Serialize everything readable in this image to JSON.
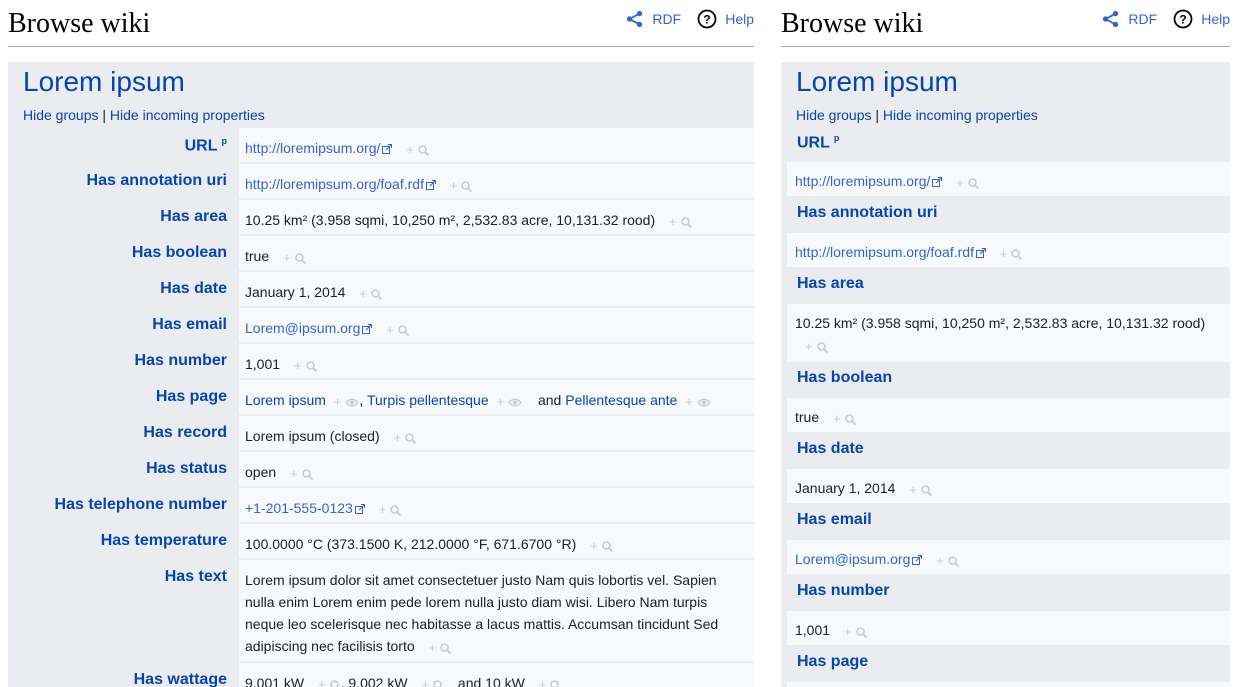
{
  "header": {
    "title": "Browse wiki",
    "rdf_label": "RDF",
    "help_label": "Help"
  },
  "subject": {
    "title": "Lorem ipsum",
    "hide_groups": "Hide groups",
    "divider": "|",
    "hide_incoming": "Hide incoming properties"
  },
  "properties": [
    {
      "label": "URL",
      "sup": "p",
      "values": [
        {
          "text": "http://loremipsum.org/",
          "link": true,
          "ext": true
        }
      ]
    },
    {
      "label": "Has annotation uri",
      "values": [
        {
          "text": "http://loremipsum.org/foaf.rdf",
          "link": true,
          "ext": true
        }
      ]
    },
    {
      "label": "Has area",
      "values": [
        {
          "text": "10.25 km² (3.958 sqmi, 10,250 m², 2,532.83 acre, 10,131.32 rood)"
        }
      ]
    },
    {
      "label": "Has boolean",
      "values": [
        {
          "text": "true"
        }
      ]
    },
    {
      "label": "Has date",
      "values": [
        {
          "text": "January 1, 2014"
        }
      ]
    },
    {
      "label": "Has email",
      "values": [
        {
          "text": "Lorem@ipsum.org",
          "link": true,
          "ext": true
        }
      ]
    },
    {
      "label": "Has number",
      "values": [
        {
          "text": "1,001"
        }
      ]
    },
    {
      "label": "Has page",
      "values": [
        {
          "text": "Lorem ipsum",
          "link": true,
          "browse": true
        },
        {
          "text": "Turpis pellentesque",
          "link": true,
          "browse": true
        },
        {
          "text": "Pellentesque ante",
          "link": true,
          "browse": true
        }
      ],
      "separators": [
        ", ",
        "and"
      ]
    },
    {
      "label": "Has record",
      "values": [
        {
          "text": "Lorem ipsum (closed)"
        }
      ]
    },
    {
      "label": "Has status",
      "values": [
        {
          "text": "open"
        }
      ]
    },
    {
      "label": "Has telephone number",
      "values": [
        {
          "text": "+1-201-555-0123",
          "link": true,
          "ext": true
        }
      ]
    },
    {
      "label": "Has temperature",
      "values": [
        {
          "text": "100.0000 °C (373.1500 K, 212.0000 °F, 671.6700 °R)"
        }
      ]
    },
    {
      "label": "Has text",
      "values": [
        {
          "text": "Lorem ipsum dolor sit amet consectetuer justo Nam quis lobortis vel. Sapien nulla enim Lorem enim pede lorem nulla justo diam wisi. Libero Nam turpis neque leo scelerisque nec habitasse a lacus mattis. Accumsan tincidunt Sed adipiscing nec facilisis torto"
        }
      ]
    },
    {
      "label": "Has wattage",
      "values": [
        {
          "text": "9.001 kW"
        },
        {
          "text": "9.002 kW"
        },
        {
          "text": "10 kW"
        }
      ],
      "separators": [
        ", ",
        "and"
      ]
    }
  ],
  "icons": {
    "rdf": "share-icon",
    "help": "question-circle-icon",
    "external": "external-link-icon",
    "search": "search-icon",
    "browse": "eye-icon",
    "plus": "+"
  },
  "colors": {
    "link": "#3366cc",
    "internal_link": "#0645ad",
    "label_bg": "#eaecf0",
    "value_bg": "#f8f9fa",
    "action_icon": "#c8ccd1"
  }
}
